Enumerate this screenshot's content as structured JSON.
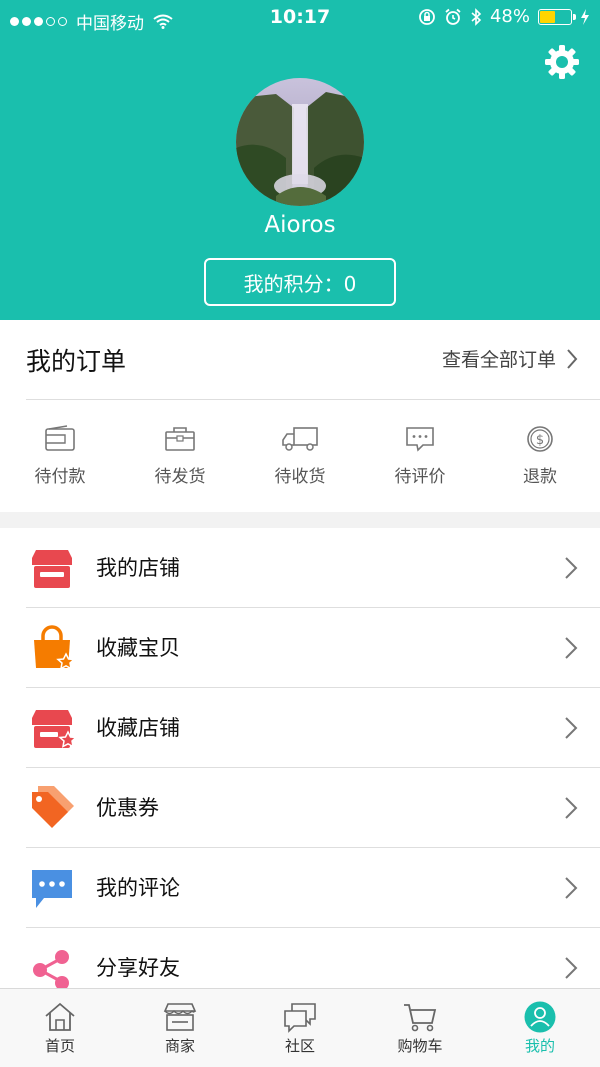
{
  "status_bar": {
    "carrier": "中国移动",
    "time": "10:17",
    "battery": "48%",
    "battery_level": 0.48
  },
  "profile": {
    "username": "Aioros",
    "points_label": "我的积分：0"
  },
  "orders": {
    "title": "我的订单",
    "view_all": "查看全部订单",
    "items": [
      {
        "label": "待付款",
        "icon": "wallet-icon"
      },
      {
        "label": "待发货",
        "icon": "package-icon"
      },
      {
        "label": "待收货",
        "icon": "truck-icon"
      },
      {
        "label": "待评价",
        "icon": "comment-icon"
      },
      {
        "label": "退款",
        "icon": "refund-icon"
      }
    ]
  },
  "menu": [
    {
      "label": "我的店铺",
      "icon": "store-icon",
      "color": "#e8484f"
    },
    {
      "label": "收藏宝贝",
      "icon": "bag-star-icon",
      "color": "#f57c00"
    },
    {
      "label": "收藏店铺",
      "icon": "store-star-icon",
      "color": "#e8484f"
    },
    {
      "label": "优惠券",
      "icon": "tag-icon",
      "color": "#f26522"
    },
    {
      "label": "我的评论",
      "icon": "chat-icon",
      "color": "#4a90e2"
    },
    {
      "label": "分享好友",
      "icon": "share-icon",
      "color": "#f06292"
    }
  ],
  "tabs": [
    {
      "label": "首页",
      "icon": "home-icon"
    },
    {
      "label": "商家",
      "icon": "shop-icon"
    },
    {
      "label": "社区",
      "icon": "community-icon"
    },
    {
      "label": "购物车",
      "icon": "cart-icon"
    },
    {
      "label": "我的",
      "icon": "user-icon",
      "active": true
    }
  ],
  "colors": {
    "primary": "#1abfad",
    "background": "#f2f2f2"
  }
}
